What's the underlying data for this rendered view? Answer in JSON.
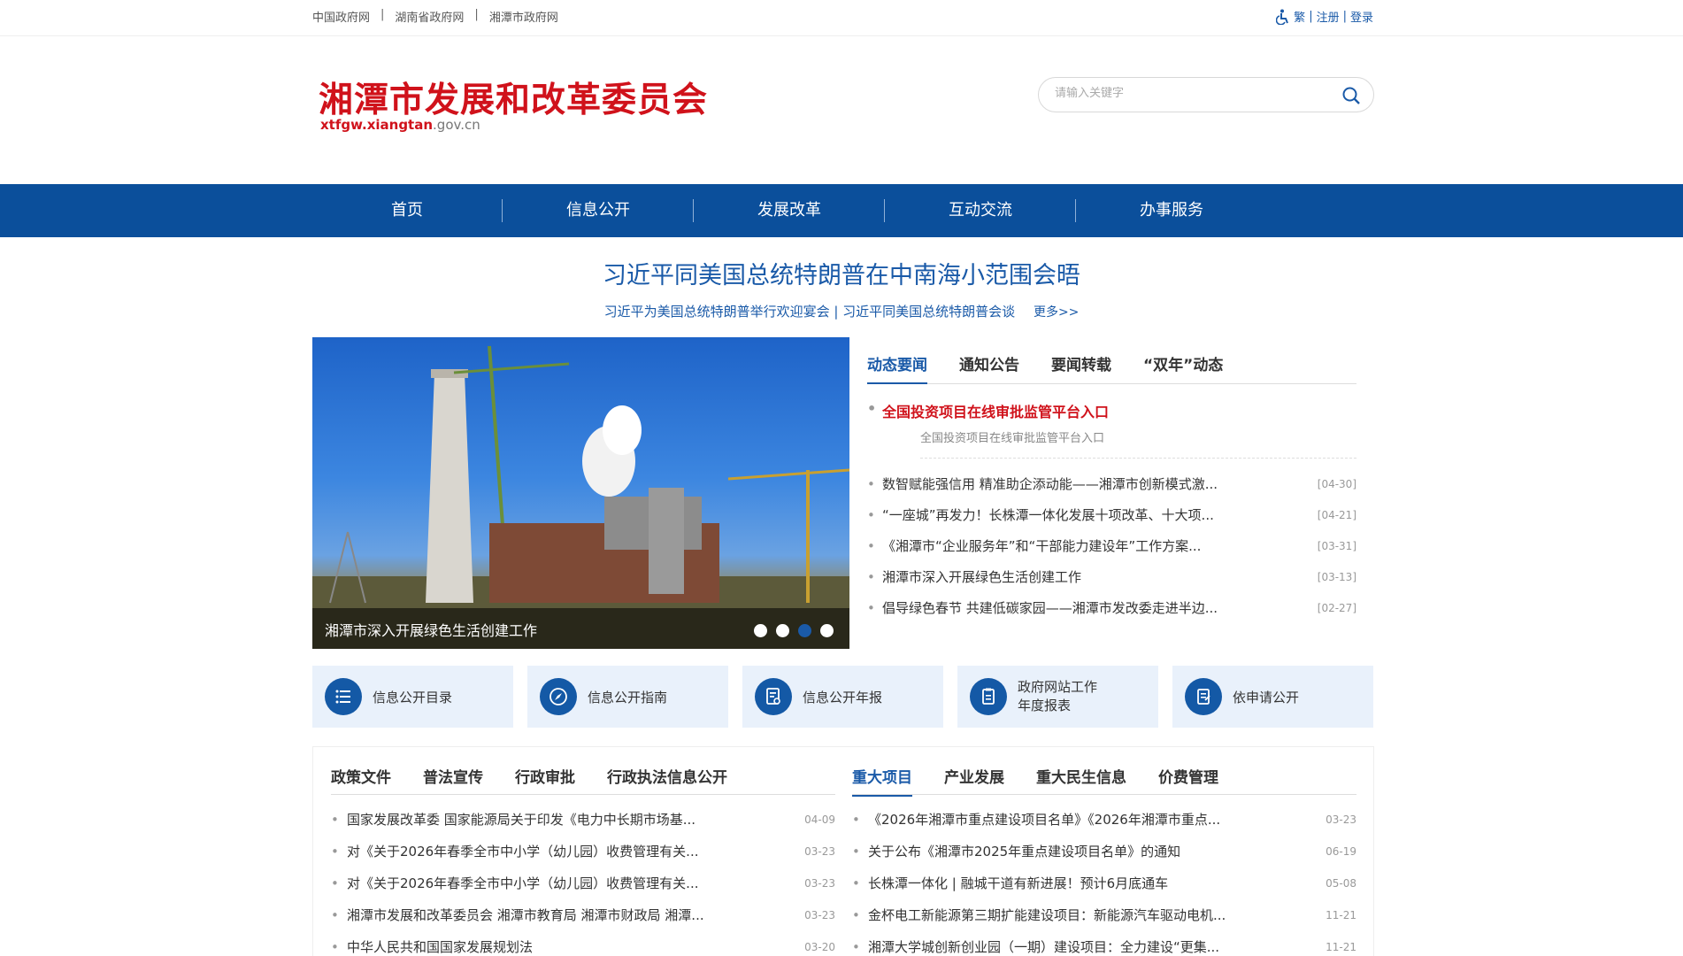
{
  "topbar": {
    "links": [
      "中国政府网",
      "湖南省政府网",
      "湘潭市政府网"
    ],
    "right": [
      "繁",
      "注册",
      "登录"
    ]
  },
  "header": {
    "title": "湘潭市发展和改革委员会",
    "domain_bold": "xtfgw.xiangtan",
    "domain_rest": ".gov.cn",
    "search_placeholder": "请输入关键字"
  },
  "nav": [
    "首页",
    "信息公开",
    "发展改革",
    "互动交流",
    "办事服务"
  ],
  "headline": {
    "title": "习近平同美国总统特朗普在中南海小范围会晤",
    "sub": "习近平为美国总统特朗普举行欢迎宴会 | 习近平同美国总统特朗普会谈",
    "more": "更多>>"
  },
  "slider": {
    "caption": "湘潭市深入开展绿色生活创建工作",
    "active_dot": 3
  },
  "news": {
    "tabs": [
      "动态要闻",
      "通知公告",
      "要闻转载",
      "“双年”动态"
    ],
    "featured_title": "全国投资项目在线审批监管平台入口",
    "featured_sub": "全国投资项目在线审批监管平台入口",
    "items": [
      {
        "title": "数智赋能强信用 精准助企添动能——湘潭市创新模式激...",
        "date": "[04-30]"
      },
      {
        "title": "“一座城”再发力！长株潭一体化发展十项改革、十大项...",
        "date": "[04-21]"
      },
      {
        "title": "《湘潭市“企业服务年”和“干部能力建设年”工作方案...",
        "date": "[03-31]"
      },
      {
        "title": "湘潭市深入开展绿色生活创建工作",
        "date": "[03-13]"
      },
      {
        "title": "倡导绿色春节 共建低碳家园——湘潭市发改委走进半边...",
        "date": "[02-27]"
      }
    ]
  },
  "quick": [
    {
      "line1": "信息公开目录",
      "line2": ""
    },
    {
      "line1": "信息公开指南",
      "line2": ""
    },
    {
      "line1": "信息公开年报",
      "line2": ""
    },
    {
      "line1": "政府网站工作",
      "line2": "年度报表"
    },
    {
      "line1": "依申请公开",
      "line2": ""
    }
  ],
  "left_panel": {
    "tabs": [
      "政策文件",
      "普法宣传",
      "行政审批",
      "行政执法信息公开"
    ],
    "items": [
      {
        "title": "国家发展改革委 国家能源局关于印发《电力中长期市场基...",
        "date": "04-09"
      },
      {
        "title": "对《关于2026年春季全市中小学（幼儿园）收费管理有关...",
        "date": "03-23"
      },
      {
        "title": "对《关于2026年春季全市中小学（幼儿园）收费管理有关...",
        "date": "03-23"
      },
      {
        "title": "湘潭市发展和改革委员会 湘潭市教育局 湘潭市财政局 湘潭...",
        "date": "03-23"
      },
      {
        "title": "中华人民共和国国家发展规划法",
        "date": "03-20"
      }
    ]
  },
  "right_panel": {
    "tabs": [
      "重大项目",
      "产业发展",
      "重大民生信息",
      "价费管理"
    ],
    "items": [
      {
        "title": "《2026年湘潭市重点建设项目名单》《2026年湘潭市重点...",
        "date": "03-23"
      },
      {
        "title": "关于公布《湘潭市2025年重点建设项目名单》的通知",
        "date": "06-19"
      },
      {
        "title": "长株潭一体化 | 融城干道有新进展！预计6月底通车",
        "date": "05-08"
      },
      {
        "title": "金杯电工新能源第三期扩能建设项目：新能源汽车驱动电机...",
        "date": "11-21"
      },
      {
        "title": "湘潭大学城创新创业园（一期）建设项目：全力建设“更集...",
        "date": "11-21"
      }
    ]
  },
  "colors": {
    "brand_red": "#d0121b",
    "nav_blue": "#0b4f9b",
    "link_blue": "#1a5aa8",
    "quick_bg": "#e9f1fb"
  }
}
